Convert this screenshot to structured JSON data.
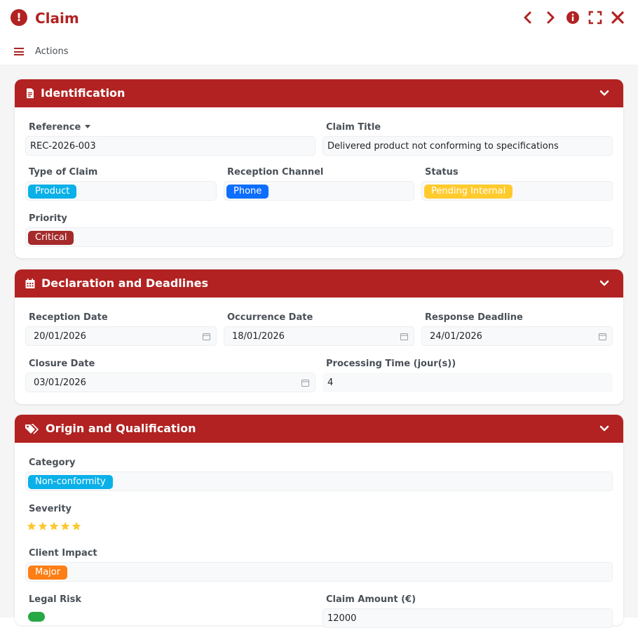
{
  "window": {
    "title": "Claim",
    "actions_label": "Actions",
    "icons": [
      "exclamation-circle-icon",
      "chevron-left-icon",
      "chevron-right-icon",
      "info-circle-icon",
      "expand-icon",
      "close-icon",
      "hamburger-icon"
    ]
  },
  "colors": {
    "accent": "#b22222",
    "product": "#0ab0e8",
    "phone": "#0d6efd",
    "pending": "#ffca2c",
    "critical": "#a52a2a",
    "major": "#fd7e14",
    "star": "#fdc82f",
    "toggle": "#28a745"
  },
  "identification": {
    "title": "Identification",
    "reference": {
      "label": "Reference",
      "value": "REC-2026-003"
    },
    "claim_title": {
      "label": "Claim Title",
      "value": "Delivered product not conforming to specifications"
    },
    "type_of_claim": {
      "label": "Type of Claim",
      "value": "Product"
    },
    "reception_channel": {
      "label": "Reception Channel",
      "value": "Phone"
    },
    "status": {
      "label": "Status",
      "value": "Pending Internal"
    },
    "priority": {
      "label": "Priority",
      "value": "Critical"
    }
  },
  "declaration": {
    "title": "Declaration and Deadlines",
    "reception_date": {
      "label": "Reception Date",
      "value": "20/01/2026"
    },
    "occurrence_date": {
      "label": "Occurrence Date",
      "value": "18/01/2026"
    },
    "response_deadline": {
      "label": "Response Deadline",
      "value": "24/01/2026"
    },
    "closure_date": {
      "label": "Closure Date",
      "value": "03/01/2026"
    },
    "processing_time": {
      "label": "Processing Time (jour(s))",
      "value": "4"
    }
  },
  "origin": {
    "title": "Origin and Qualification",
    "category": {
      "label": "Category",
      "value": "Non-conformity"
    },
    "severity": {
      "label": "Severity",
      "stars": 5,
      "max": 5
    },
    "client_impact": {
      "label": "Client Impact",
      "value": "Major"
    },
    "legal_risk": {
      "label": "Legal Risk",
      "enabled": true
    },
    "claim_amount": {
      "label": "Claim Amount (€)",
      "value": "12000"
    }
  }
}
